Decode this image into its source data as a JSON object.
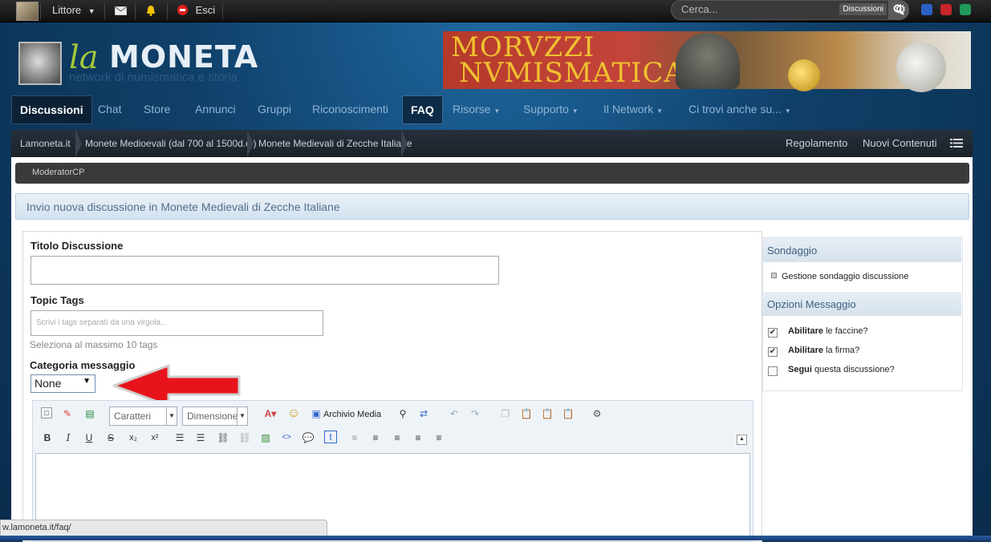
{
  "topbar": {
    "user": "Littore",
    "logout": "Esci",
    "search_placeholder": "Cerca...",
    "search_scope": "Discussioni"
  },
  "header": {
    "logo_la": "la",
    "logo_moneta": "MONETA",
    "logo_sub": "network di numismatica e storia",
    "banner_line1": "MORVZZI",
    "banner_line2": "NVMISMATICA"
  },
  "nav": {
    "items": [
      "Discussioni",
      "Chat",
      "Store",
      "Annunci",
      "Gruppi",
      "Riconoscimenti",
      "FAQ",
      "Risorse",
      "Supporto",
      "Il Network",
      "Ci trovi anche su..."
    ]
  },
  "breadcrumb": {
    "items": [
      "Lamoneta.it",
      "Monete Medioevali (dal 700 al 1500d.c.)",
      "Monete Medievali di Zecche Italiane"
    ],
    "right": [
      "Regolamento",
      "Nuovi Contenuti"
    ]
  },
  "modbar": {
    "label": "ModeratorCP"
  },
  "page": {
    "title": "Invio nuova discussione in Monete Medievali di Zecche Italiane"
  },
  "form": {
    "title_label": "Titolo Discussione",
    "tags_label": "Topic Tags",
    "tags_placeholder": "Scrivi i tags separati da una virgola...",
    "tags_hint": "Seleziona al massimo 10 tags",
    "category_label": "Categoria messaggio",
    "category_value": "None"
  },
  "editor": {
    "font_dd": "Caratteri",
    "size_dd": "Dimensione",
    "media": "Archivio Media"
  },
  "sidebar": {
    "poll_header": "Sondaggio",
    "poll_item": "Gestione sondaggio discussione",
    "options_header": "Opzioni Messaggio",
    "options": [
      {
        "bold": "Abilitare",
        "rest": "le faccine?",
        "checked": true
      },
      {
        "bold": "Abilitare",
        "rest": "la firma?",
        "checked": true
      },
      {
        "bold": "Segui",
        "rest": "questa discussione?",
        "checked": false
      }
    ]
  },
  "status": {
    "url": "w.lamoneta.it/faq/"
  },
  "colors": {
    "accent_red": "#e8141c",
    "nav_text": "#8eb4d6"
  }
}
